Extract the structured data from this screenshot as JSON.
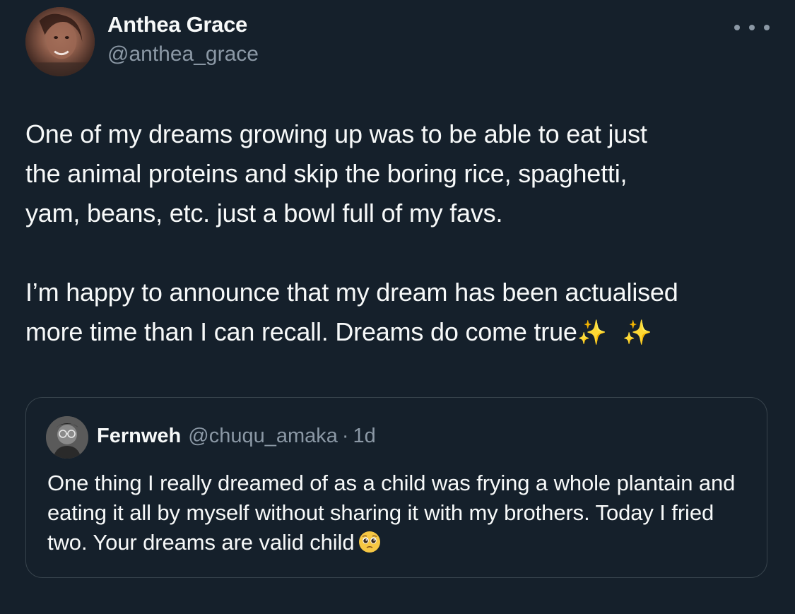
{
  "tweet": {
    "author_name": "Anthea Grace",
    "author_handle": "@anthea_grace",
    "more_icon": "more-horizontal-icon",
    "text": "One of my dreams growing up was to be able to eat just\nthe animal proteins and skip the boring rice, spaghetti,\nyam, beans, etc. just a bowl full of my favs.\n\nI’m happy to announce that my dream has been actualised\nmore time than I can recall. Dreams do come true",
    "trailing_emoji": "✨ ✨"
  },
  "quote": {
    "author_name": "Fernweh",
    "author_handle": "@chuqu_amaka",
    "separator": "·",
    "time": "1d",
    "text": "One thing I really dreamed of as a child was frying a whole plantain and eating it all by myself without sharing it with my brothers. Today I fried two. Your dreams are valid child",
    "trailing_emoji_icon": "pleading-face-emoji"
  },
  "colors": {
    "background": "#15202b",
    "primary_text": "#f7f9f9",
    "secondary_text": "#8b98a5",
    "border": "#38444d"
  }
}
